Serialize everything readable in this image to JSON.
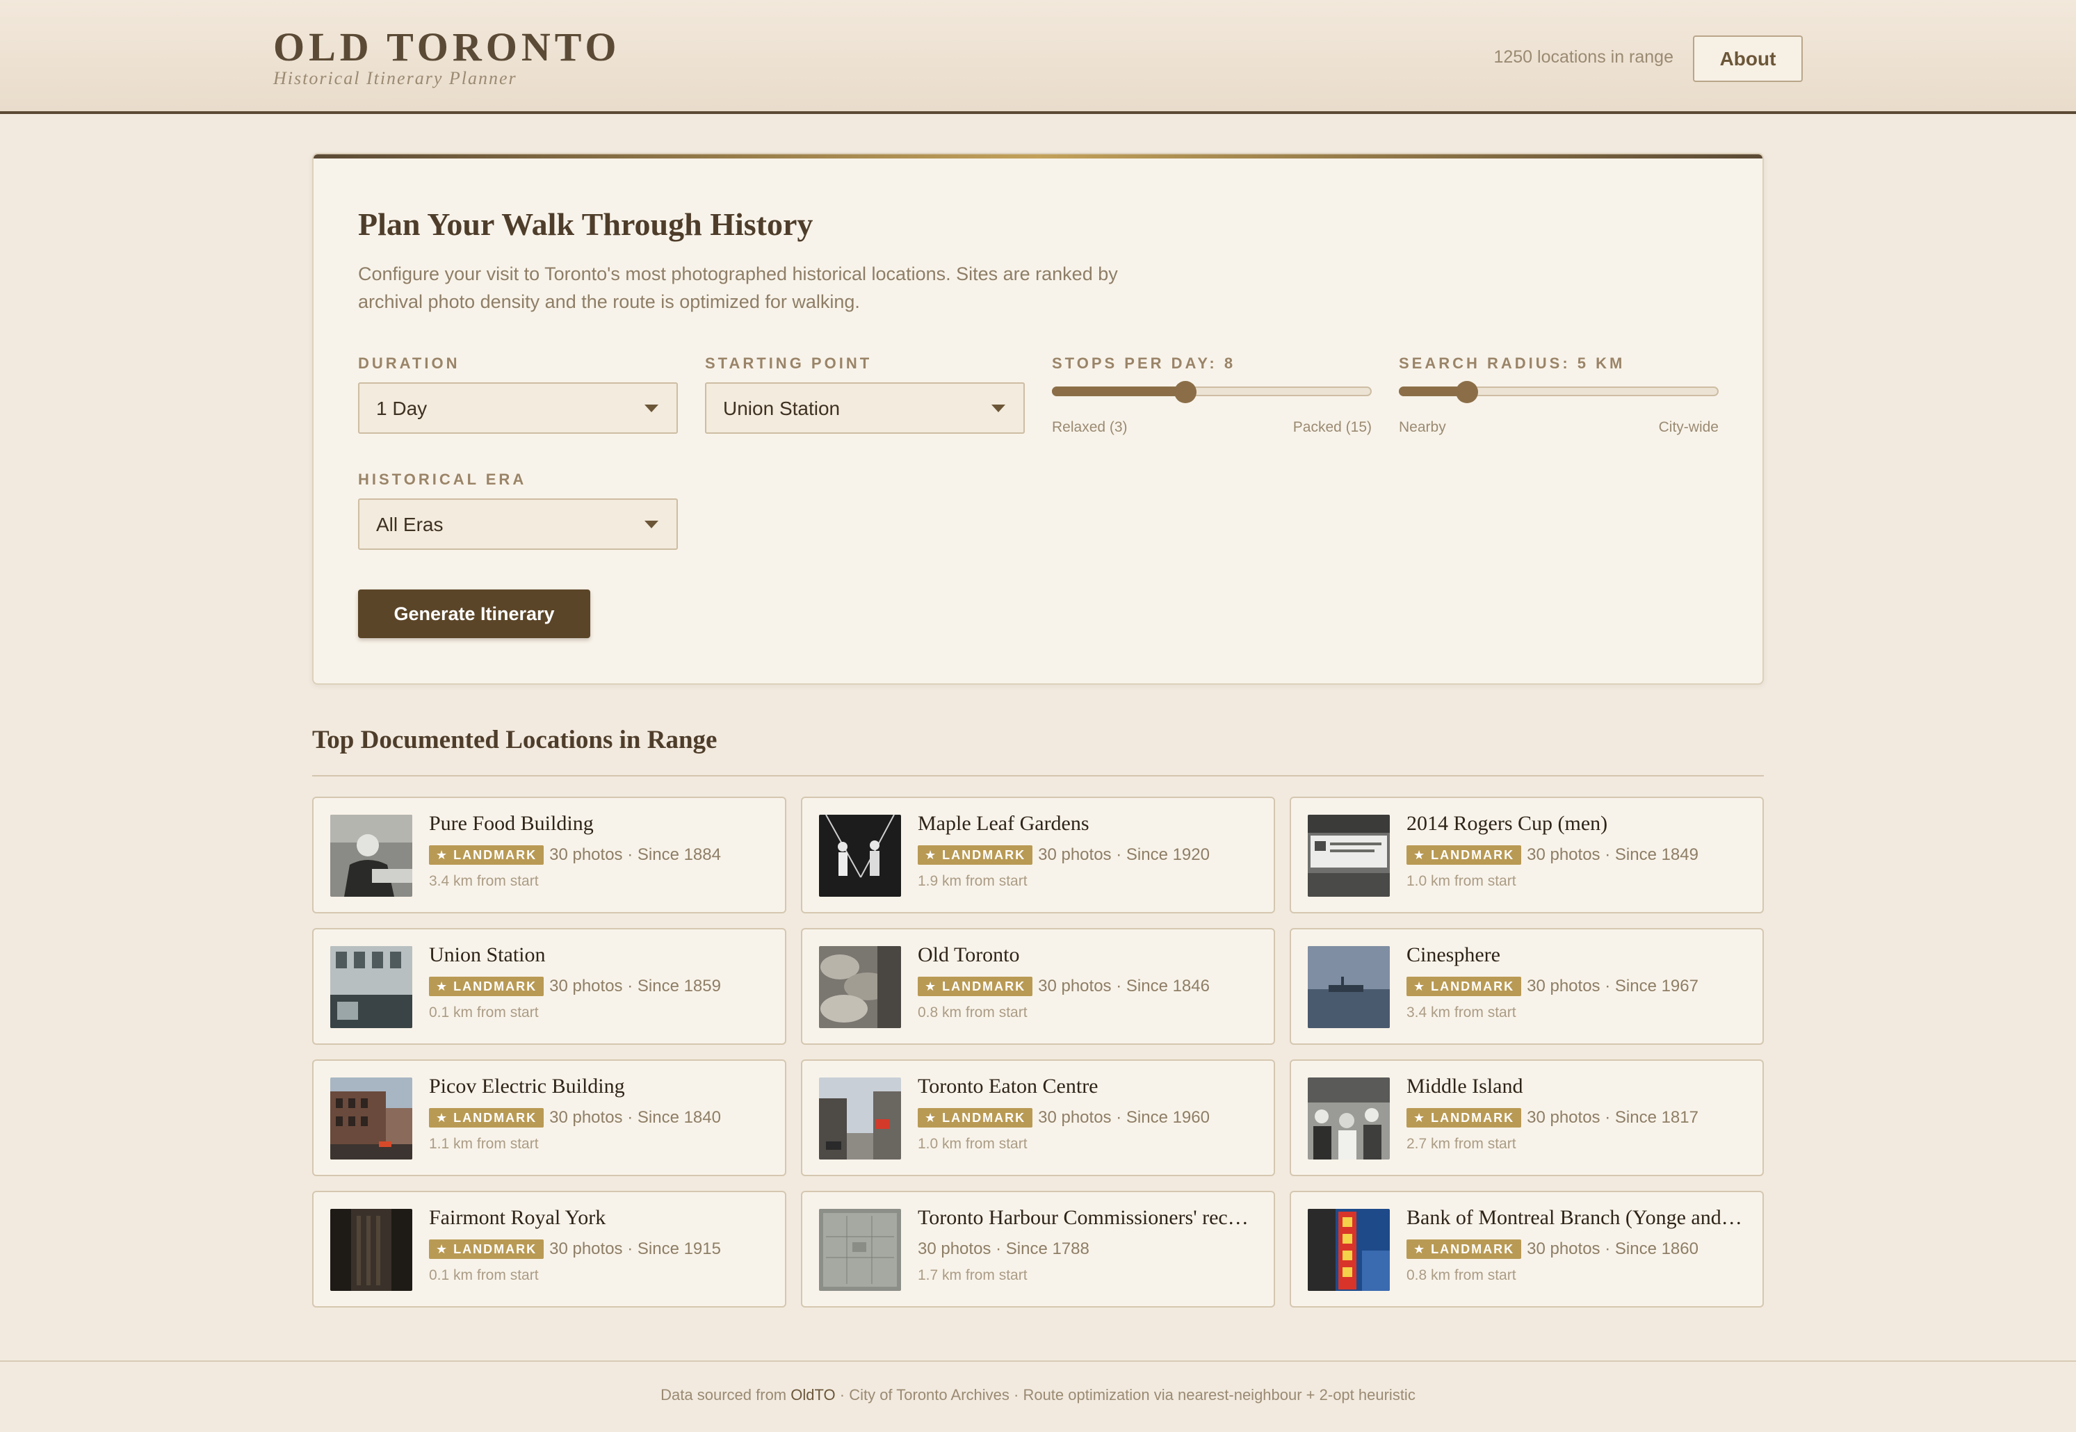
{
  "header": {
    "title": "OLD TORONTO",
    "subtitle": "Historical Itinerary Planner",
    "locations_count": "1250 locations in range",
    "about_label": "About"
  },
  "planner": {
    "title": "Plan Your Walk Through History",
    "description": "Configure your visit to Toronto's most photographed historical locations. Sites are ranked by archival photo density and the route is optimized for walking.",
    "duration": {
      "label": "DURATION",
      "value": "1 Day"
    },
    "starting_point": {
      "label": "STARTING POINT",
      "value": "Union Station"
    },
    "stops_per_day": {
      "label": "STOPS PER DAY: 8",
      "value": 8,
      "min": 3,
      "max": 15,
      "min_label": "Relaxed (3)",
      "max_label": "Packed (15)"
    },
    "search_radius": {
      "label": "SEARCH RADIUS: 5 KM",
      "value": 5,
      "min": 1,
      "max": 20,
      "min_label": "Nearby",
      "max_label": "City-wide"
    },
    "era": {
      "label": "HISTORICAL ERA",
      "value": "All Eras"
    },
    "generate_label": "Generate Itinerary",
    "accent_color": "#8b6e48",
    "button_color": "#5b4528"
  },
  "locations": {
    "title": "Top Documented Locations in Range",
    "badge_label": "★ LANDMARK",
    "items": [
      {
        "name": "Pure Food Building",
        "landmark": true,
        "stats": "30 photos · Since 1884",
        "distance": "3.4 km from start",
        "thumb": "portrait-photo"
      },
      {
        "name": "Maple Leaf Gardens",
        "landmark": true,
        "stats": "30 photos · Since 1920",
        "distance": "1.9 km from start",
        "thumb": "athletes-photo"
      },
      {
        "name": "2014 Rogers Cup (men)",
        "landmark": true,
        "stats": "30 photos · Since 1849",
        "distance": "1.0 km from start",
        "thumb": "memorial-sign-photo"
      },
      {
        "name": "Union Station",
        "landmark": true,
        "stats": "30 photos · Since 1859",
        "distance": "0.1 km from start",
        "thumb": "storefront-photo"
      },
      {
        "name": "Old Toronto",
        "landmark": true,
        "stats": "30 photos · Since 1846",
        "distance": "0.8 km from start",
        "thumb": "sacks-photo"
      },
      {
        "name": "Cinesphere",
        "landmark": true,
        "stats": "30 photos · Since 1967",
        "distance": "3.4 km from start",
        "thumb": "harbour-photo"
      },
      {
        "name": "Picov Electric Building",
        "landmark": true,
        "stats": "30 photos · Since 1840",
        "distance": "1.1 km from start",
        "thumb": "brick-building-photo"
      },
      {
        "name": "Toronto Eaton Centre",
        "landmark": true,
        "stats": "30 photos · Since 1960",
        "distance": "1.0 km from start",
        "thumb": "street-photo"
      },
      {
        "name": "Middle Island",
        "landmark": true,
        "stats": "30 photos · Since 1817",
        "distance": "2.7 km from start",
        "thumb": "crowd-photo"
      },
      {
        "name": "Fairmont Royal York",
        "landmark": true,
        "stats": "30 photos · Since 1915",
        "distance": "0.1 km from start",
        "thumb": "dark-tower-photo"
      },
      {
        "name": "Toronto Harbour Commissioners' recyc...",
        "landmark": false,
        "stats": "30 photos · Since 1788",
        "distance": "1.7 km from start",
        "thumb": "map-document-photo"
      },
      {
        "name": "Bank of Montreal Branch (Yonge and Q...",
        "landmark": true,
        "stats": "30 photos · Since 1860",
        "distance": "0.8 km from start",
        "thumb": "neon-sign-photo"
      }
    ]
  },
  "footer": {
    "prefix": "Data sourced from ",
    "link": "OldTO",
    "suffix": " · City of Toronto Archives · Route optimization via nearest-neighbour + 2-opt heuristic"
  }
}
